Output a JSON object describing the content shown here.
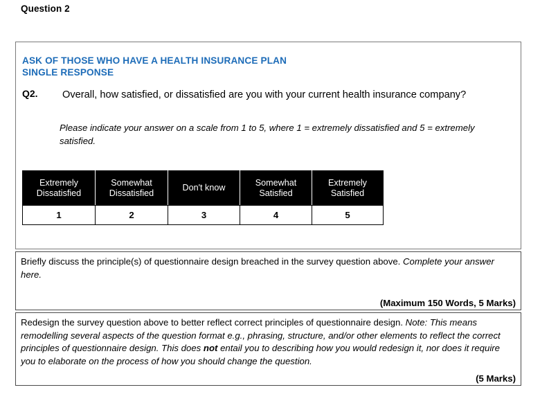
{
  "page": {
    "question_heading": "Question 2"
  },
  "survey": {
    "screener_line_1": "ASK OF THOSE WHO HAVE A HEALTH INSURANCE PLAN",
    "screener_line_2": "SINGLE RESPONSE",
    "screener_color": "#1d6cb8",
    "question_number": "Q2.",
    "question_text": "Overall, how satisfied, or dissatisfied are you with your current health insurance company?",
    "instruction_text": "Please indicate your answer on a scale from 1 to 5, where 1 = extremely dissatisfied and 5 = extremely satisfied.",
    "scale": {
      "header_bg": "#000000",
      "header_fg": "#ffffff",
      "labels": [
        "Extremely Dissatisfied",
        "Somewhat Dissatisfied",
        "Don't know",
        "Somewhat Satisfied",
        "Extremely Satisfied"
      ],
      "labels_line1": [
        "Extremely",
        "Somewhat",
        "Don't know",
        "Somewhat",
        "Extremely"
      ],
      "labels_line2": [
        "Dissatisfied",
        "Dissatisfied",
        "",
        "Satisfied",
        "Satisfied"
      ],
      "values": [
        "1",
        "2",
        "3",
        "4",
        "5"
      ]
    }
  },
  "answers": [
    {
      "prompt_plain": "Briefly discuss the principle(s) of questionnaire design breached in the survey question above.",
      "prompt_italic": "Complete your answer here.",
      "marks": "(Maximum 150 Words, 5 Marks)"
    },
    {
      "prompt_plain": "Redesign the survey question above to better reflect correct principles of questionnaire design.",
      "note_part_1": "Note: This means remodelling several aspects of the question format e.g., phrasing, structure, and/or other elements to reflect the correct principles of questionnaire design. This does ",
      "note_bold": "not",
      "note_part_2": " entail you to describing how you would redesign it, nor does it require you to elaborate on the process of how you should change the question.",
      "marks": "(5 Marks)"
    }
  ]
}
